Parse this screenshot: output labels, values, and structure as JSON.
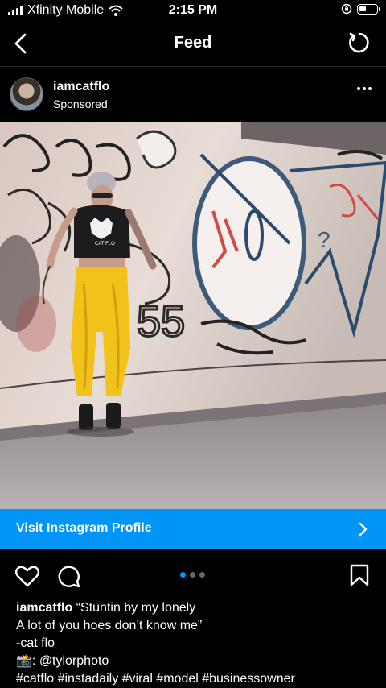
{
  "status": {
    "carrier": "Xfinity Mobile",
    "time": "2:15 PM"
  },
  "nav": {
    "title": "Feed"
  },
  "post": {
    "username": "iamcatflo",
    "label": "Sponsored",
    "image_icon": "photo",
    "shirt_text": "CAT FLO",
    "graffiti_text": "55"
  },
  "cta": {
    "label": "Visit Instagram Profile"
  },
  "carousel": {
    "count": 3,
    "active_index": 0
  },
  "caption": {
    "username": "iamcatflo",
    "line1": " “Stuntin by my lonely",
    "line2": "A lot of you hoes don’t know me”",
    "line3": "-cat flo",
    "line4": "📸: @tylorphoto",
    "line5": "#catflo #instadaily #viral #model #businessowner"
  },
  "colors": {
    "accent": "#0095f6",
    "background": "#000000",
    "pants": "#f2c21a"
  }
}
